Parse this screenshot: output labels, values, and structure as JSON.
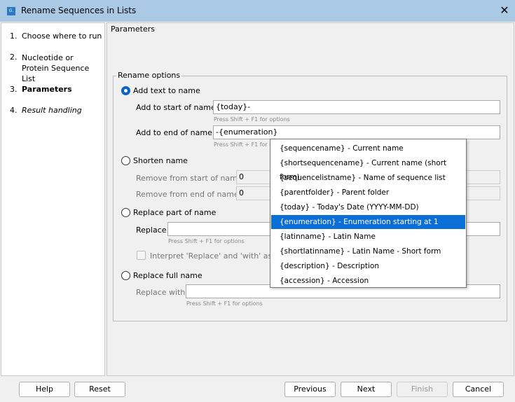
{
  "window": {
    "title": "Rename Sequences in Lists",
    "close": "✕",
    "icon": "G."
  },
  "steps": [
    {
      "num": "1.",
      "label": "Choose where to run"
    },
    {
      "num": "2.",
      "label": "Nucleotide or Protein Sequence List"
    },
    {
      "num": "3.",
      "label": "Parameters"
    },
    {
      "num": "4.",
      "label": "Result handling"
    }
  ],
  "panel": {
    "title": "Parameters",
    "group": "Rename options"
  },
  "add": {
    "label": "Add text to name",
    "start_label": "Add to start of name",
    "start_value": "{today}-",
    "end_label": "Add to end of name",
    "end_value": "-{enumeration}",
    "hint": "Press Shift + F1 for options"
  },
  "shorten": {
    "label": "Shorten name",
    "start_label": "Remove from start of name",
    "start_value": "0",
    "end_label": "Remove from end of name",
    "end_value": "0"
  },
  "replace_part": {
    "label": "Replace part of name",
    "replace_label": "Replace",
    "replace_value": "",
    "hint": "Press Shift + F1 for options",
    "checkbox_label": "Interpret 'Replace' and 'with' as Ja"
  },
  "replace_full": {
    "label": "Replace full name",
    "with_label": "Replace with",
    "with_value": "",
    "hint": "Press Shift + F1 for options"
  },
  "popup": {
    "selected_index": 5,
    "items": [
      "{sequencename} - Current name",
      "{shortsequencename} - Current name (short form)",
      "{sequencelistname} - Name of sequence list",
      "{parentfolder} - Parent folder",
      "{today} - Today's Date (YYYY-MM-DD)",
      "{enumeration} - Enumeration starting at 1",
      "{latinname} - Latin Name",
      "{shortlatinname} - Latin Name - Short form",
      "{description} - Description",
      "{accession} - Accession"
    ]
  },
  "buttons": {
    "help": "Help",
    "reset": "Reset",
    "previous": "Previous",
    "next": "Next",
    "finish": "Finish",
    "cancel": "Cancel"
  },
  "colors": {
    "titlebar": "#aac9e5",
    "accent": "#0c6ed7"
  }
}
